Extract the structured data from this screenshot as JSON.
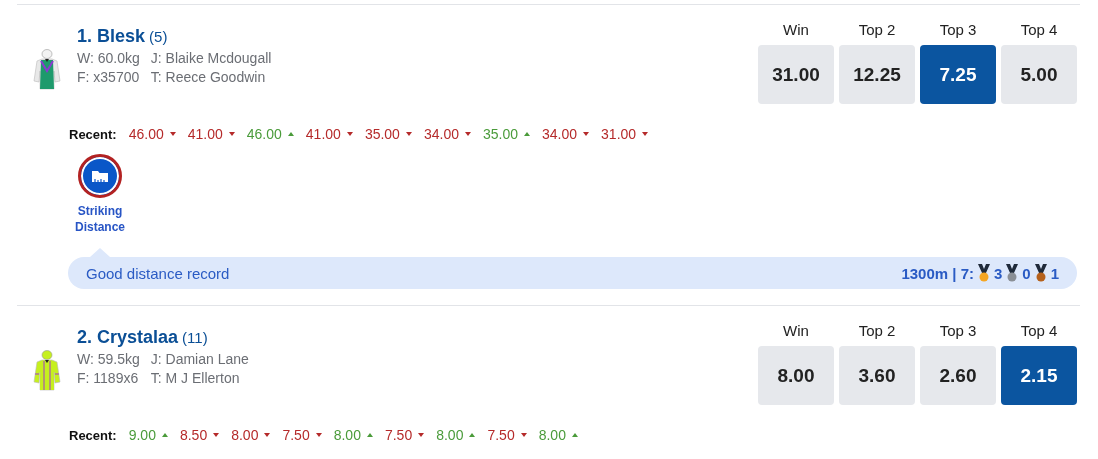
{
  "runners": [
    {
      "name": "1. Blesk",
      "barrier": "(5)",
      "weight": "W: 60.0kg",
      "jockey": "J: Blaike Mcdougall",
      "form": "F: x35700",
      "trainer": "T: Reece Goodwin",
      "odds": [
        {
          "label": "Win",
          "price": "31.00",
          "selected": false
        },
        {
          "label": "Top 2",
          "price": "12.25",
          "selected": false
        },
        {
          "label": "Top 3",
          "price": "7.25",
          "selected": true
        },
        {
          "label": "Top 4",
          "price": "5.00",
          "selected": false
        }
      ],
      "recent_label": "Recent:",
      "recent": [
        {
          "price": "46.00",
          "kind": "down"
        },
        {
          "price": "41.00",
          "kind": "down"
        },
        {
          "price": "46.00",
          "kind": "up"
        },
        {
          "price": "41.00",
          "kind": "down"
        },
        {
          "price": "35.00",
          "kind": "down"
        },
        {
          "price": "34.00",
          "kind": "down"
        },
        {
          "price": "35.00",
          "kind": "up"
        },
        {
          "price": "34.00",
          "kind": "down"
        },
        {
          "price": "31.00",
          "kind": "down"
        }
      ],
      "insight": {
        "badge": "Striking Distance",
        "text": "Good distance record",
        "stat": "1300m | 7:",
        "medals": [
          {
            "kind": "gold",
            "count": "3"
          },
          {
            "kind": "silver",
            "count": "0"
          },
          {
            "kind": "bronze",
            "count": "1"
          }
        ]
      }
    },
    {
      "name": "2. Crystalaa",
      "barrier": "(11)",
      "weight": "W: 59.5kg",
      "jockey": "J: Damian Lane",
      "form": "F: 1189x6",
      "trainer": "T: M J Ellerton",
      "odds": [
        {
          "label": "Win",
          "price": "8.00",
          "selected": false
        },
        {
          "label": "Top 2",
          "price": "3.60",
          "selected": false
        },
        {
          "label": "Top 3",
          "price": "2.60",
          "selected": false
        },
        {
          "label": "Top 4",
          "price": "2.15",
          "selected": true
        }
      ],
      "recent_label": "Recent:",
      "recent": [
        {
          "price": "9.00",
          "kind": "up"
        },
        {
          "price": "8.50",
          "kind": "down"
        },
        {
          "price": "8.00",
          "kind": "down"
        },
        {
          "price": "7.50",
          "kind": "down"
        },
        {
          "price": "8.00",
          "kind": "up"
        },
        {
          "price": "7.50",
          "kind": "down"
        },
        {
          "price": "8.00",
          "kind": "up"
        },
        {
          "price": "7.50",
          "kind": "down"
        },
        {
          "price": "8.00",
          "kind": "up"
        }
      ]
    }
  ]
}
